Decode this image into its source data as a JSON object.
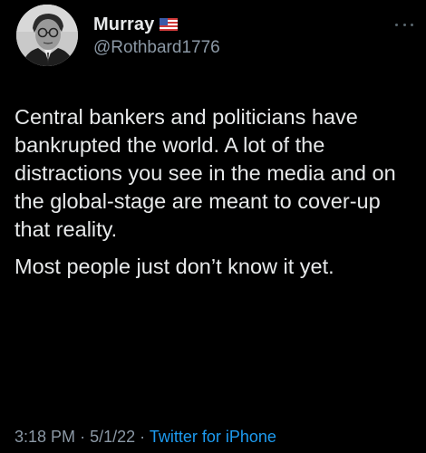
{
  "tweet": {
    "display_name": "Murray",
    "handle": "@Rothbard1776",
    "flag_icon": "us-flag-icon",
    "more_icon": "more-options-icon",
    "paragraphs": [
      "Central bankers and politicians have bankrupted the world. A lot of the distractions you see in the media and on the global-stage are meant to cover-up that reality.",
      "Most people just don’t know it yet."
    ],
    "time": "3:18 PM",
    "separator": "·",
    "date": "5/1/22",
    "source": "Twitter for iPhone"
  },
  "colors": {
    "background": "#000000",
    "text": "#e7e9ea",
    "secondary": "#8b98a5",
    "link": "#1d9bf0"
  }
}
